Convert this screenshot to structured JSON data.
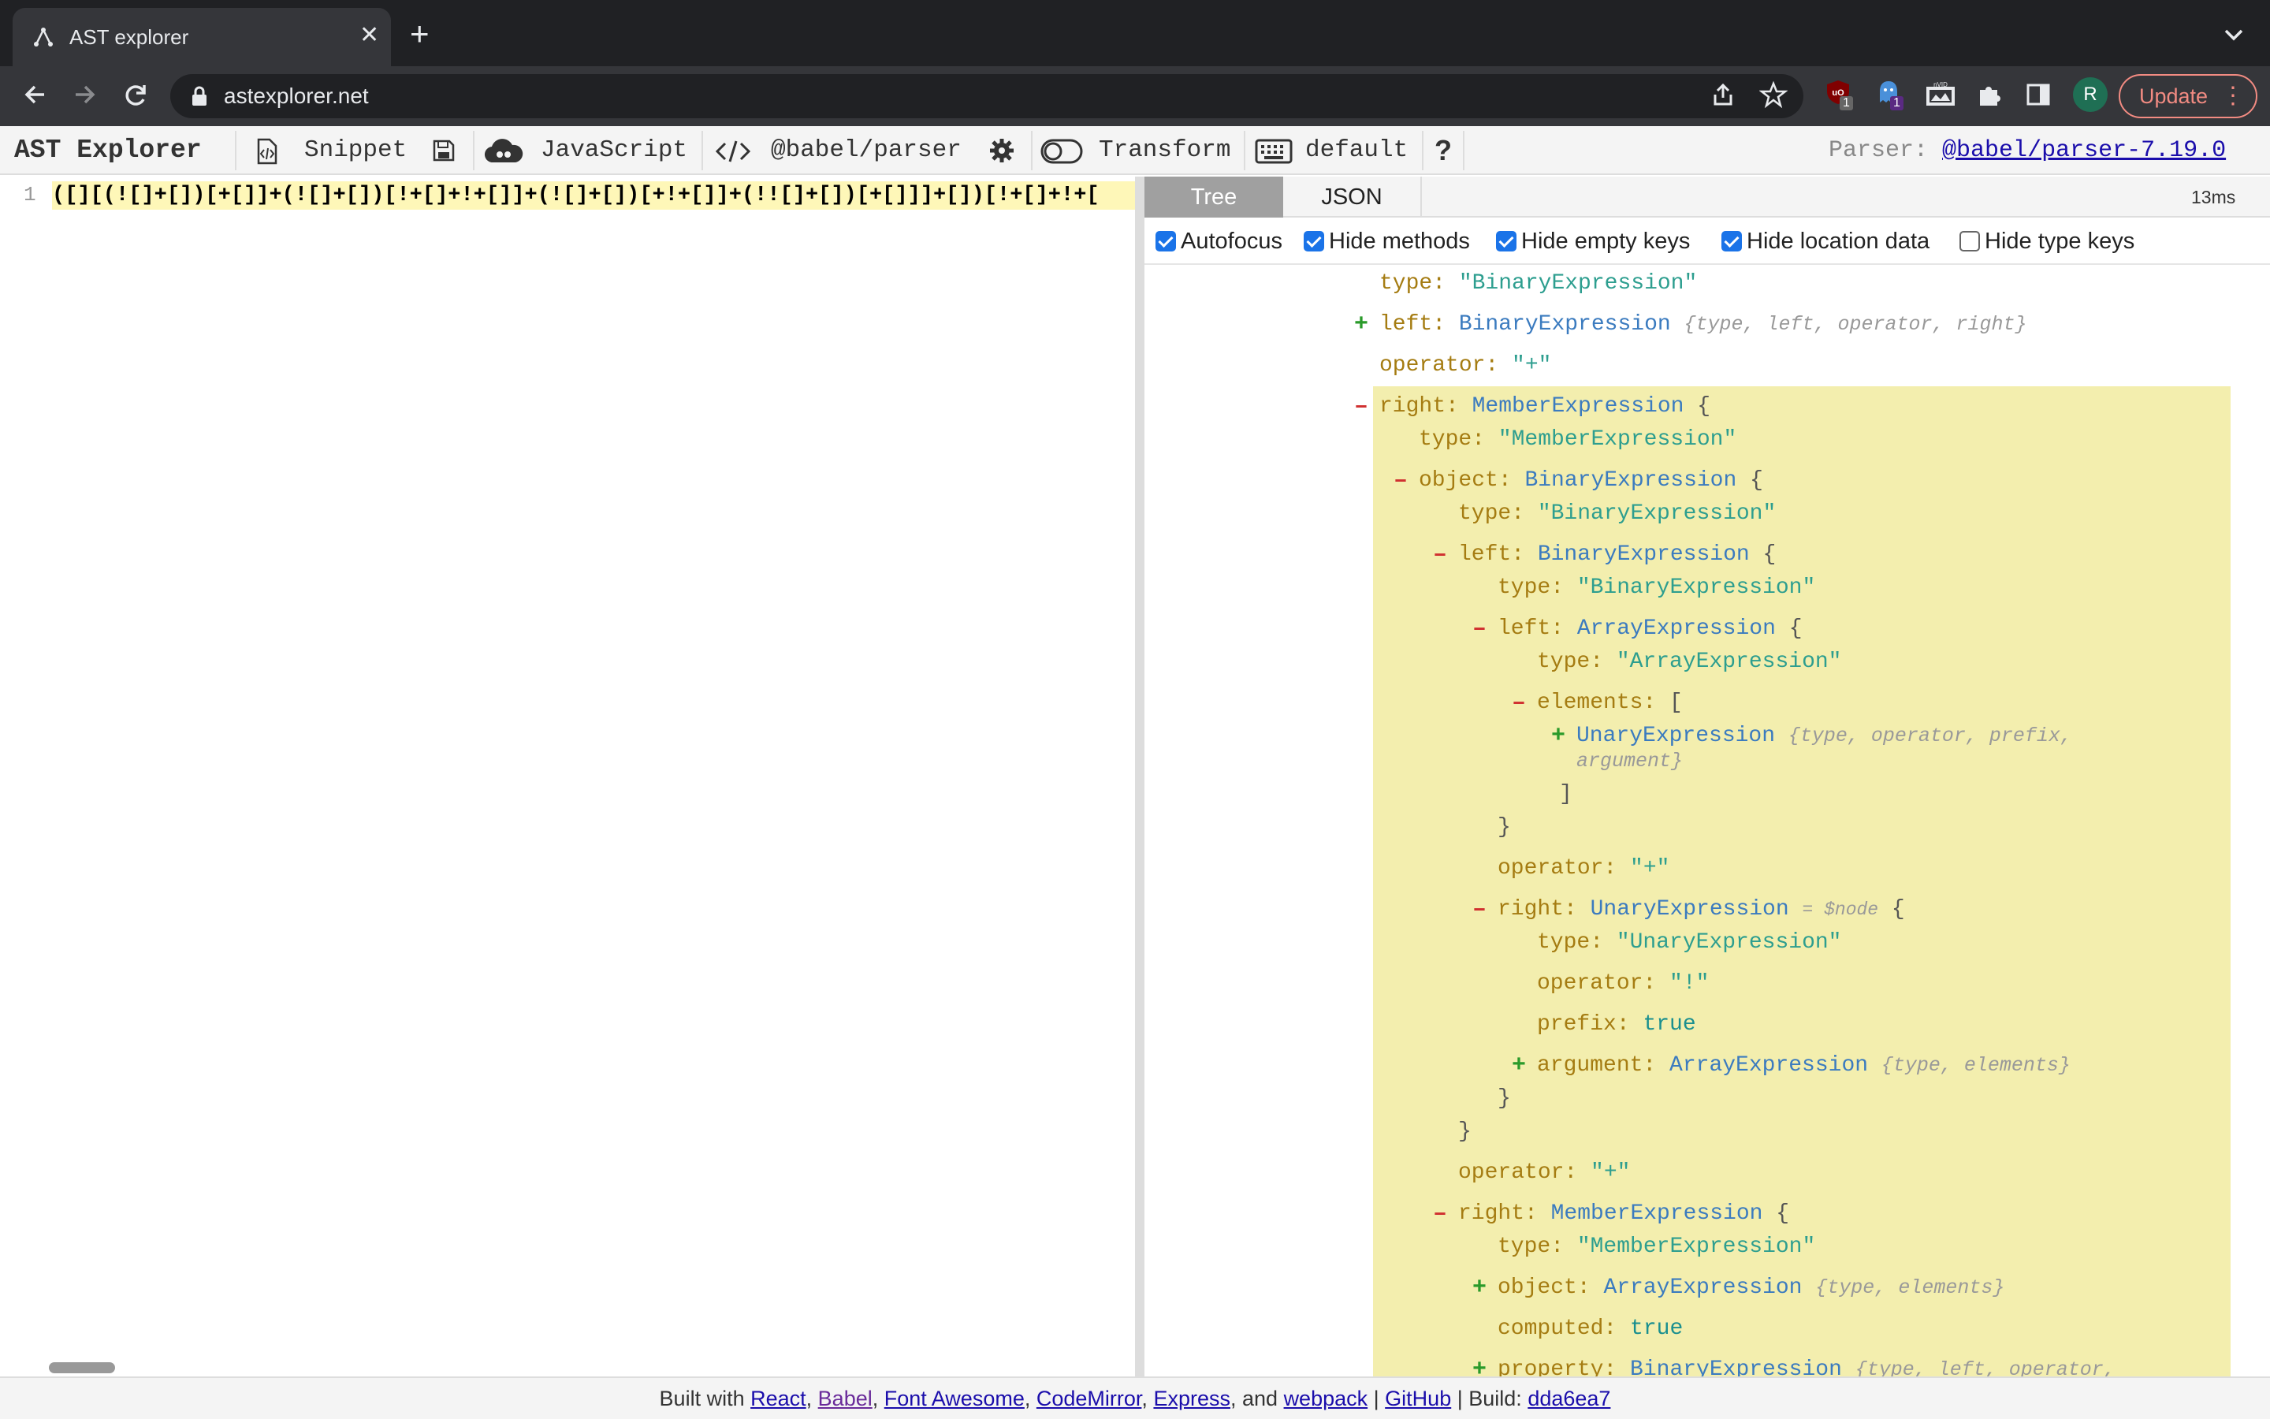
{
  "browser": {
    "tab_title": "AST explorer",
    "url": "astexplorer.net",
    "update_label": "Update",
    "avatar_letter": "R",
    "ext_badge_1": "1",
    "ext_badge_2": "1"
  },
  "app": {
    "title": "AST Explorer",
    "snippet_label": "Snippet",
    "language_label": "JavaScript",
    "parser_label": "@babel/parser",
    "transform_label": "Transform",
    "keymap_label": "default",
    "help_label": "?",
    "parser_info_prefix": "Parser:",
    "parser_info_link": "@babel/parser-7.19.0"
  },
  "editor": {
    "line_number": "1",
    "code": "([][(![]+[])[+[]]+(![]+[])[!+[]+!+[]]+(![]+[])[+!+[]]+(!![]+[])[+[]]]+[])[!+[]+!+["
  },
  "output": {
    "tabs": [
      "Tree",
      "JSON"
    ],
    "timing": "13ms",
    "options": [
      {
        "label": "Autofocus",
        "checked": true
      },
      {
        "label": "Hide methods",
        "checked": true
      },
      {
        "label": "Hide empty keys",
        "checked": true
      },
      {
        "label": "Hide location data",
        "checked": true
      },
      {
        "label": "Hide type keys",
        "checked": false
      }
    ]
  },
  "tree": {
    "l01": {
      "key": "type",
      "str": "\"BinaryExpression\""
    },
    "l02": {
      "toggle": "+",
      "key": "left",
      "type": "BinaryExpression",
      "fields": "{type, left, operator, right}"
    },
    "l03": {
      "key": "operator",
      "str": "\"+\""
    },
    "l04": {
      "toggle": "-",
      "key": "right",
      "type": "MemberExpression",
      "brace": "{"
    },
    "l05": {
      "key": "type",
      "str": "\"MemberExpression\""
    },
    "l06": {
      "toggle": "-",
      "key": "object",
      "type": "BinaryExpression",
      "brace": "{"
    },
    "l07": {
      "key": "type",
      "str": "\"BinaryExpression\""
    },
    "l08": {
      "toggle": "-",
      "key": "left",
      "type": "BinaryExpression",
      "brace": "{"
    },
    "l09": {
      "key": "type",
      "str": "\"BinaryExpression\""
    },
    "l10": {
      "toggle": "-",
      "key": "left",
      "type": "ArrayExpression",
      "brace": "{"
    },
    "l11": {
      "key": "type",
      "str": "\"ArrayExpression\""
    },
    "l12": {
      "toggle": "-",
      "key": "elements",
      "brace": "["
    },
    "l13": {
      "toggle": "+",
      "type": "UnaryExpression",
      "fields": "{type, operator, prefix,",
      "fields2": "argument}"
    },
    "l14": {
      "brace": "]"
    },
    "l15": {
      "brace": "}"
    },
    "l16": {
      "key": "operator",
      "str": "\"+\""
    },
    "l17": {
      "toggle": "-",
      "key": "right",
      "type": "UnaryExpression",
      "note": "= $node",
      "brace": "{"
    },
    "l18": {
      "key": "type",
      "str": "\"UnaryExpression\""
    },
    "l19": {
      "key": "operator",
      "str": "\"!\""
    },
    "l20": {
      "key": "prefix",
      "kw": "true"
    },
    "l21": {
      "toggle": "+",
      "key": "argument",
      "type": "ArrayExpression",
      "fields": "{type, elements}"
    },
    "l22": {
      "brace": "}"
    },
    "l23": {
      "brace": "}"
    },
    "l24": {
      "key": "operator",
      "str": "\"+\""
    },
    "l25": {
      "toggle": "-",
      "key": "right",
      "type": "MemberExpression",
      "brace": "{"
    },
    "l26": {
      "key": "type",
      "str": "\"MemberExpression\""
    },
    "l27": {
      "toggle": "+",
      "key": "object",
      "type": "ArrayExpression",
      "fields": "{type, elements}"
    },
    "l28": {
      "key": "computed",
      "kw": "true"
    },
    "l29": {
      "toggle": "+",
      "key": "property",
      "type": "BinaryExpression",
      "fields": "{type, left, operator,"
    }
  },
  "footer": {
    "built_with": "Built with",
    "react": "React",
    "babel": "Babel",
    "font_awesome": "Font Awesome",
    "codemirror": "CodeMirror",
    "express": "Express",
    "and": ", and",
    "webpack": "webpack",
    "github": "GitHub",
    "build_label": "| Build:",
    "build_hash": "dda6ea7"
  },
  "colors": {
    "highlight": "#f3eeae",
    "code_highlight": "#fef7b8",
    "chrome_dark": "#202124",
    "update_accent": "#f28b82",
    "checkbox": "#1a73e8"
  }
}
